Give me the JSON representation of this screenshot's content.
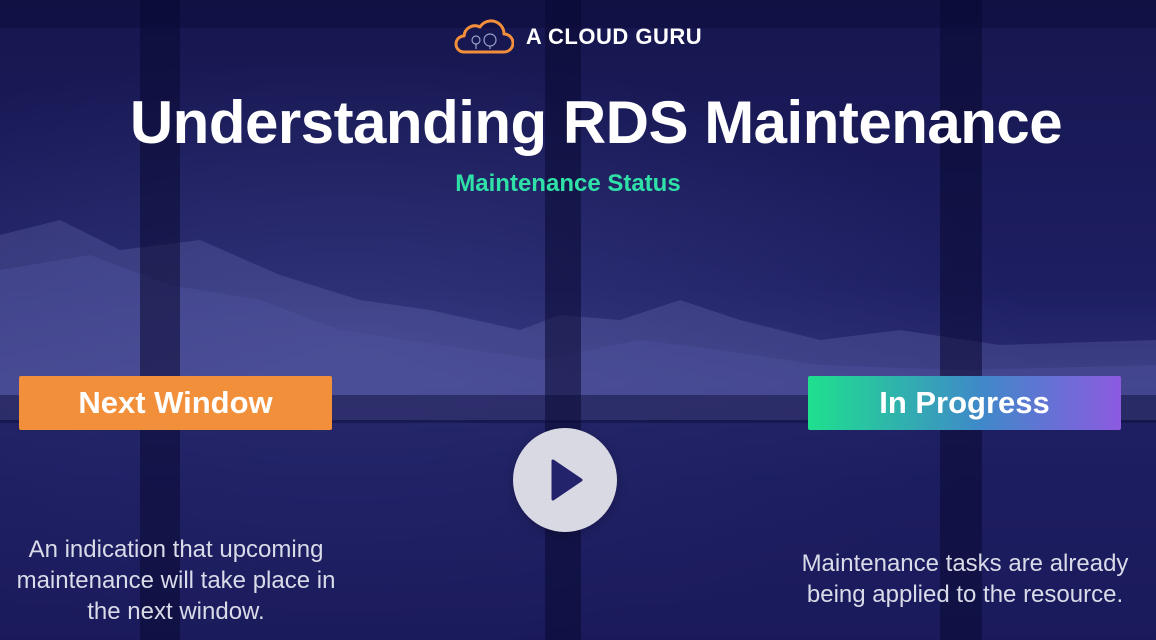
{
  "brand": {
    "name": "A CLOUD GURU"
  },
  "slide": {
    "title": "Understanding RDS Maintenance",
    "subtitle": "Maintenance Status"
  },
  "statuses": [
    {
      "label": "Next Window",
      "description": "An indication that upcoming maintenance will take place in the next window.",
      "color": "#f28f3b"
    },
    {
      "label": "In Progress",
      "description": "Maintenance tasks are already being applied to the resource.",
      "gradient": [
        "#1ee08e",
        "#8c5ae0"
      ]
    }
  ],
  "player": {
    "play_icon": "play-icon"
  },
  "colors": {
    "background": "#1a1a5c",
    "accent_green": "#2fe0a7",
    "logo_orange": "#f28f3b"
  }
}
